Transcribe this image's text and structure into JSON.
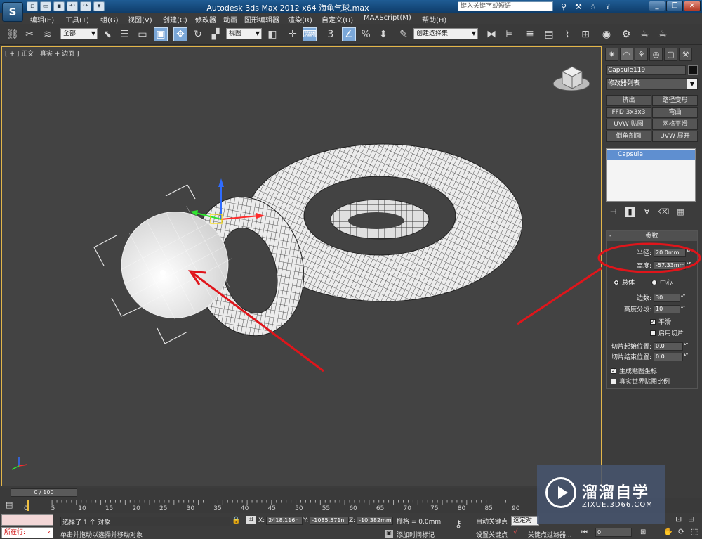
{
  "window": {
    "logo": "S",
    "title": "Autodesk 3ds Max  2012 x64     海龟气球.max",
    "search_placeholder": "键入关键字或短语",
    "qa_icons": [
      "new-icon",
      "open-icon",
      "save-icon",
      "undo-icon",
      "redo-icon",
      "dropdown-icon"
    ]
  },
  "menu": [
    "编辑(E)",
    "工具(T)",
    "组(G)",
    "视图(V)",
    "创建(C)",
    "修改器",
    "动画",
    "图形编辑器",
    "渲染(R)",
    "自定义(U)",
    "MAXScript(M)",
    "帮助(H)"
  ],
  "toolbar": {
    "selection_filter": "全部",
    "reference_coord": "视图",
    "named_selection": "创建选择集",
    "angle_snap_label": "3",
    "percent_label": "%"
  },
  "viewport": {
    "label": "[ + ] 正交 | 真实 + 边面 ]",
    "accent_color": "#e3b64a",
    "annotation_color": "#e0151b"
  },
  "command_panel": {
    "object_name": "Capsule119",
    "modifier_list": "修改器列表",
    "modifier_buttons": [
      "挤出",
      "路径变形",
      "FFD 3x3x3",
      "弯曲",
      "UVW 贴图",
      "网格平滑",
      "倒角剖面",
      "UVW 展开"
    ],
    "stack_items": [
      "Capsule"
    ],
    "rollout_title": "参数",
    "radius_label": "半径:",
    "radius_value": "20.0mm",
    "height_label": "高度:",
    "height_value": "-57.33mm",
    "total_label": "总体",
    "center_label": "中心",
    "sides_label": "边数:",
    "sides_value": "30",
    "height_segs_label": "高度分段:",
    "height_segs_value": "10",
    "smooth_label": "平滑",
    "slice_on_label": "启用切片",
    "slice_from_label": "切片起始位置:",
    "slice_from_value": "0.0",
    "slice_to_label": "切片结束位置:",
    "slice_to_value": "0.0",
    "gen_uv_label": "生成贴图坐标",
    "real_world_label": "真实世界贴图比例"
  },
  "timeline": {
    "frame_display": "0 / 100",
    "ticks": [
      "0",
      "5",
      "10",
      "15",
      "20",
      "25",
      "30",
      "35",
      "40",
      "45",
      "50",
      "55",
      "60",
      "65",
      "70",
      "75",
      "80",
      "85",
      "90"
    ]
  },
  "status": {
    "listener_label": "所在行:",
    "selection_text": "选择了 1 个 对象",
    "prompt_text": "单击并拖动以选择并移动对象",
    "x_label": "X:",
    "x_value": "2418.116n",
    "y_label": "Y:",
    "y_value": "-1085.571n",
    "z_label": "Z:",
    "z_value": "-10.382mm",
    "grid_text": "栅格 = 0.0mm",
    "auto_key": "自动关键点",
    "set_key": "设置关键点",
    "selected_object": "选定对",
    "add_time_tag": "添加时间标记",
    "key_filters": "关键点过滤器...",
    "frame_value": "0"
  },
  "watermark": {
    "title": "溜溜自学",
    "url": "ZIXUE.3D66.COM"
  }
}
